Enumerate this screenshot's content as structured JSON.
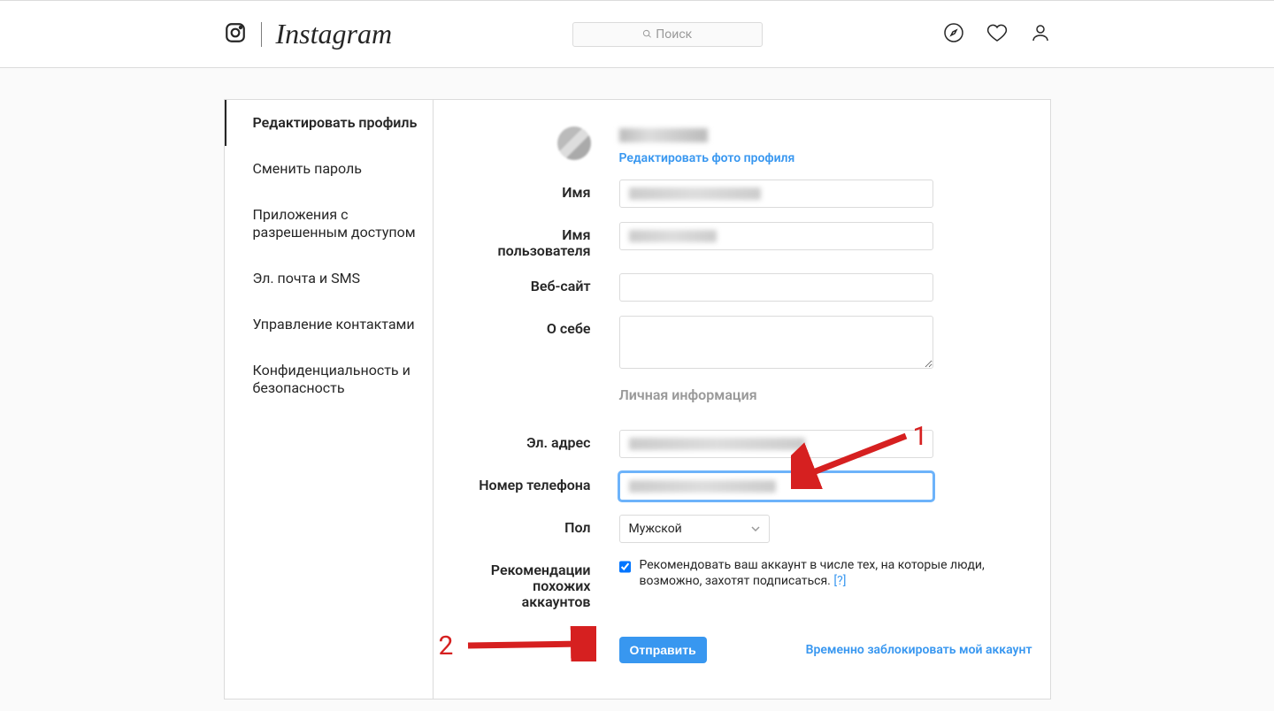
{
  "header": {
    "logo": "Instagram",
    "search_placeholder": "Поиск"
  },
  "sidebar": {
    "items": [
      "Редактировать профиль",
      "Сменить пароль",
      "Приложения с разрешенным доступом",
      "Эл. почта и SMS",
      "Управление контактами",
      "Конфиденциальность и безопасность"
    ]
  },
  "form": {
    "edit_photo": "Редактировать фото профиля",
    "labels": {
      "name": "Имя",
      "username": "Имя пользователя",
      "website": "Веб-сайт",
      "bio": "О себе",
      "personal_section": "Личная информация",
      "email": "Эл. адрес",
      "phone": "Номер телефона",
      "gender": "Пол",
      "recommendations": "Рекомендации похожих аккаунтов"
    },
    "gender_value": "Мужской",
    "recommend_text": "Рекомендовать ваш аккаунт в числе тех, на которые люди, возможно, захотят подписаться.",
    "recommend_help": "[?]",
    "submit": "Отправить",
    "disable_link": "Временно заблокировать мой аккаунт"
  },
  "annotations": {
    "one": "1",
    "two": "2"
  }
}
